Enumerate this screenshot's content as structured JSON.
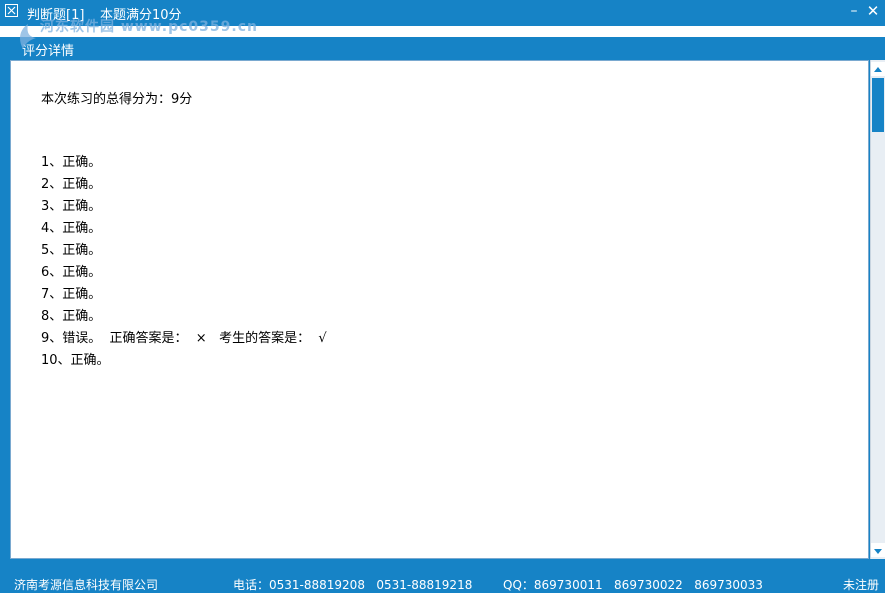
{
  "window": {
    "title": "判断题[1]",
    "score_info": "本题满分10分",
    "minimize_glyph": "–",
    "close_glyph": "✕"
  },
  "watermark": {
    "text": "河东软件园  www.pc0359.cn"
  },
  "panel": {
    "header": "评分详情"
  },
  "content": {
    "total": "本次练习的总得分为：9分",
    "results": [
      "1、正确。",
      "2、正确。",
      "3、正确。",
      "4、正确。",
      "5、正确。",
      "6、正确。",
      "7、正确。",
      "8、正确。",
      "9、错误。  正确答案是：  ×   考生的答案是：  √",
      "10、正确。"
    ]
  },
  "status": {
    "company": "济南考源信息科技有限公司",
    "phone": "电话：0531-88819208   0531-88819218",
    "qq": "QQ：869730011   869730022   869730033",
    "registration": "未注册"
  },
  "colors": {
    "primary": "#1683c6",
    "content_background": "#ffffff"
  }
}
